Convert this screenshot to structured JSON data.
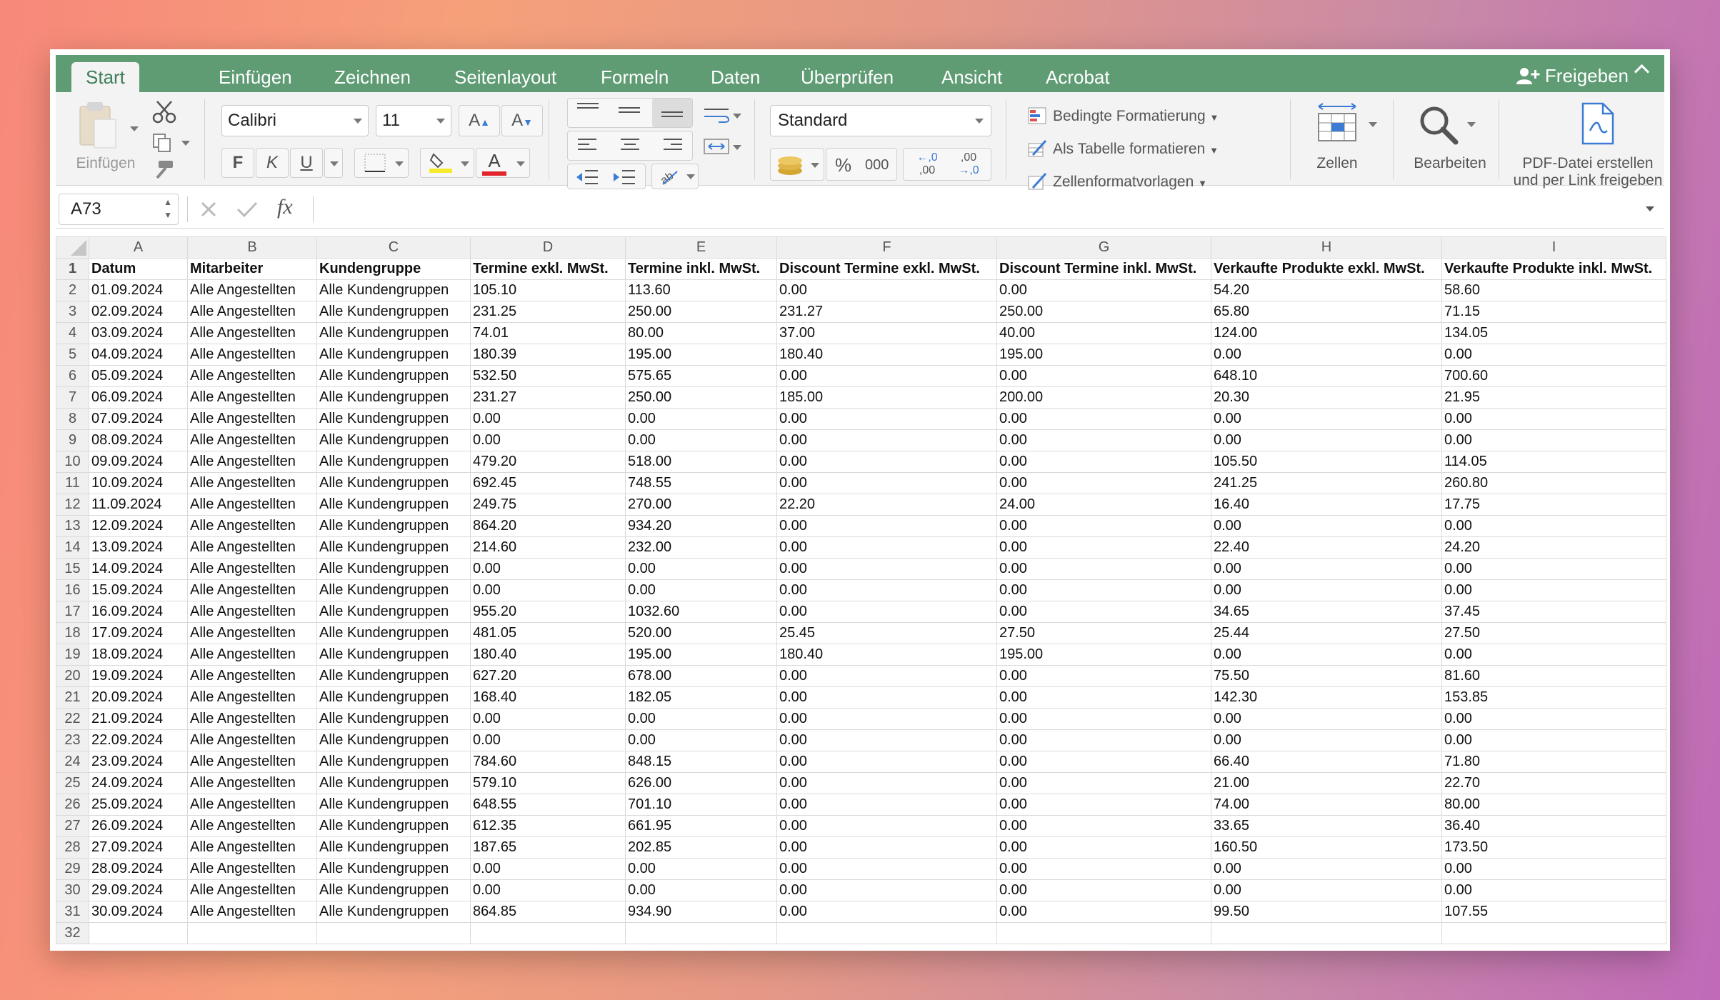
{
  "tabs": [
    "Start",
    "Einfügen",
    "Zeichnen",
    "Seitenlayout",
    "Formeln",
    "Daten",
    "Überprüfen",
    "Ansicht",
    "Acrobat"
  ],
  "share_label": "Freigeben",
  "ribbon": {
    "paste_label": "Einfügen",
    "font_name": "Calibri",
    "font_size": "11",
    "bold": "F",
    "italic": "K",
    "underline": "U",
    "font_color_glyph": "A",
    "number_format": "Standard",
    "percent": "%",
    "thousands": "000",
    "dec_inc_top": "←,0",
    "dec_inc_bottom": ",00",
    "dec_dec_top": ",00",
    "dec_dec_bottom": "→,0",
    "conditional_formatting": "Bedingte Formatierung",
    "format_as_table": "Als Tabelle formatieren",
    "cell_styles": "Zellenformatvorlagen",
    "cells_label": "Zellen",
    "edit_label": "Bearbeiten",
    "pdf_label_line1": "PDF-Datei erstellen",
    "pdf_label_line2": "und per Link freigeben"
  },
  "formula_bar": {
    "name_box": "A73",
    "fx": "fx",
    "value": ""
  },
  "columns": [
    "A",
    "B",
    "C",
    "D",
    "E",
    "F",
    "G",
    "H",
    "I"
  ],
  "headers": [
    "Datum",
    "Mitarbeiter",
    "Kundengruppe",
    "Termine exkl. MwSt.",
    "Termine inkl. MwSt.",
    "Discount Termine exkl. MwSt.",
    "Discount Termine inkl. MwSt.",
    "Verkaufte Produkte exkl. MwSt.",
    "Verkaufte Produkte inkl. MwSt."
  ],
  "rows": [
    [
      "01.09.2024",
      "Alle Angestellten",
      "Alle Kundengruppen",
      "105.10",
      "113.60",
      "0.00",
      "0.00",
      "54.20",
      "58.60"
    ],
    [
      "02.09.2024",
      "Alle Angestellten",
      "Alle Kundengruppen",
      "231.25",
      "250.00",
      "231.27",
      "250.00",
      "65.80",
      "71.15"
    ],
    [
      "03.09.2024",
      "Alle Angestellten",
      "Alle Kundengruppen",
      "74.01",
      "80.00",
      "37.00",
      "40.00",
      "124.00",
      "134.05"
    ],
    [
      "04.09.2024",
      "Alle Angestellten",
      "Alle Kundengruppen",
      "180.39",
      "195.00",
      "180.40",
      "195.00",
      "0.00",
      "0.00"
    ],
    [
      "05.09.2024",
      "Alle Angestellten",
      "Alle Kundengruppen",
      "532.50",
      "575.65",
      "0.00",
      "0.00",
      "648.10",
      "700.60"
    ],
    [
      "06.09.2024",
      "Alle Angestellten",
      "Alle Kundengruppen",
      "231.27",
      "250.00",
      "185.00",
      "200.00",
      "20.30",
      "21.95"
    ],
    [
      "07.09.2024",
      "Alle Angestellten",
      "Alle Kundengruppen",
      "0.00",
      "0.00",
      "0.00",
      "0.00",
      "0.00",
      "0.00"
    ],
    [
      "08.09.2024",
      "Alle Angestellten",
      "Alle Kundengruppen",
      "0.00",
      "0.00",
      "0.00",
      "0.00",
      "0.00",
      "0.00"
    ],
    [
      "09.09.2024",
      "Alle Angestellten",
      "Alle Kundengruppen",
      "479.20",
      "518.00",
      "0.00",
      "0.00",
      "105.50",
      "114.05"
    ],
    [
      "10.09.2024",
      "Alle Angestellten",
      "Alle Kundengruppen",
      "692.45",
      "748.55",
      "0.00",
      "0.00",
      "241.25",
      "260.80"
    ],
    [
      "11.09.2024",
      "Alle Angestellten",
      "Alle Kundengruppen",
      "249.75",
      "270.00",
      "22.20",
      "24.00",
      "16.40",
      "17.75"
    ],
    [
      "12.09.2024",
      "Alle Angestellten",
      "Alle Kundengruppen",
      "864.20",
      "934.20",
      "0.00",
      "0.00",
      "0.00",
      "0.00"
    ],
    [
      "13.09.2024",
      "Alle Angestellten",
      "Alle Kundengruppen",
      "214.60",
      "232.00",
      "0.00",
      "0.00",
      "22.40",
      "24.20"
    ],
    [
      "14.09.2024",
      "Alle Angestellten",
      "Alle Kundengruppen",
      "0.00",
      "0.00",
      "0.00",
      "0.00",
      "0.00",
      "0.00"
    ],
    [
      "15.09.2024",
      "Alle Angestellten",
      "Alle Kundengruppen",
      "0.00",
      "0.00",
      "0.00",
      "0.00",
      "0.00",
      "0.00"
    ],
    [
      "16.09.2024",
      "Alle Angestellten",
      "Alle Kundengruppen",
      "955.20",
      "1032.60",
      "0.00",
      "0.00",
      "34.65",
      "37.45"
    ],
    [
      "17.09.2024",
      "Alle Angestellten",
      "Alle Kundengruppen",
      "481.05",
      "520.00",
      "25.45",
      "27.50",
      "25.44",
      "27.50"
    ],
    [
      "18.09.2024",
      "Alle Angestellten",
      "Alle Kundengruppen",
      "180.40",
      "195.00",
      "180.40",
      "195.00",
      "0.00",
      "0.00"
    ],
    [
      "19.09.2024",
      "Alle Angestellten",
      "Alle Kundengruppen",
      "627.20",
      "678.00",
      "0.00",
      "0.00",
      "75.50",
      "81.60"
    ],
    [
      "20.09.2024",
      "Alle Angestellten",
      "Alle Kundengruppen",
      "168.40",
      "182.05",
      "0.00",
      "0.00",
      "142.30",
      "153.85"
    ],
    [
      "21.09.2024",
      "Alle Angestellten",
      "Alle Kundengruppen",
      "0.00",
      "0.00",
      "0.00",
      "0.00",
      "0.00",
      "0.00"
    ],
    [
      "22.09.2024",
      "Alle Angestellten",
      "Alle Kundengruppen",
      "0.00",
      "0.00",
      "0.00",
      "0.00",
      "0.00",
      "0.00"
    ],
    [
      "23.09.2024",
      "Alle Angestellten",
      "Alle Kundengruppen",
      "784.60",
      "848.15",
      "0.00",
      "0.00",
      "66.40",
      "71.80"
    ],
    [
      "24.09.2024",
      "Alle Angestellten",
      "Alle Kundengruppen",
      "579.10",
      "626.00",
      "0.00",
      "0.00",
      "21.00",
      "22.70"
    ],
    [
      "25.09.2024",
      "Alle Angestellten",
      "Alle Kundengruppen",
      "648.55",
      "701.10",
      "0.00",
      "0.00",
      "74.00",
      "80.00"
    ],
    [
      "26.09.2024",
      "Alle Angestellten",
      "Alle Kundengruppen",
      "612.35",
      "661.95",
      "0.00",
      "0.00",
      "33.65",
      "36.40"
    ],
    [
      "27.09.2024",
      "Alle Angestellten",
      "Alle Kundengruppen",
      "187.65",
      "202.85",
      "0.00",
      "0.00",
      "160.50",
      "173.50"
    ],
    [
      "28.09.2024",
      "Alle Angestellten",
      "Alle Kundengruppen",
      "0.00",
      "0.00",
      "0.00",
      "0.00",
      "0.00",
      "0.00"
    ],
    [
      "29.09.2024",
      "Alle Angestellten",
      "Alle Kundengruppen",
      "0.00",
      "0.00",
      "0.00",
      "0.00",
      "0.00",
      "0.00"
    ],
    [
      "30.09.2024",
      "Alle Angestellten",
      "Alle Kundengruppen",
      "864.85",
      "934.90",
      "0.00",
      "0.00",
      "99.50",
      "107.55"
    ]
  ],
  "last_row_number": "32"
}
